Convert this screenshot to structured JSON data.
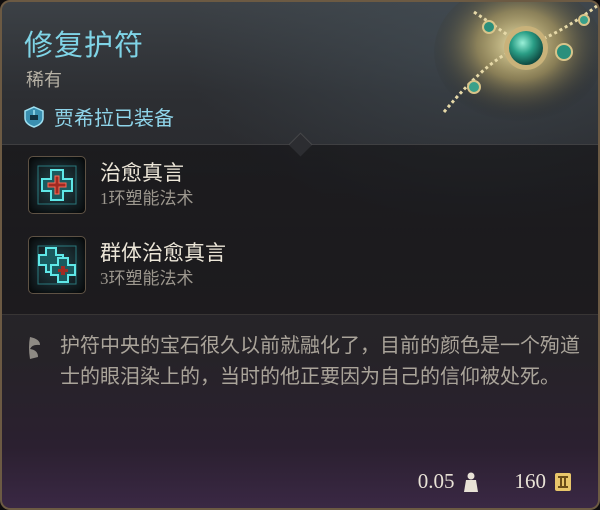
{
  "item": {
    "name": "修复护符",
    "rarity": "稀有",
    "equipped_label": "贾希拉已装备",
    "description": "护符中央的宝石很久以前就融化了，目前的颜色是一个殉道士的眼泪染上的，当时的他正要因为自己的信仰被处死。",
    "weight": "0.05",
    "price": "160"
  },
  "spells": [
    {
      "name": "治愈真言",
      "school": "1环塑能法术",
      "icon": "healing-word-icon"
    },
    {
      "name": "群体治愈真言",
      "school": "3环塑能法术",
      "icon": "mass-healing-word-icon"
    }
  ],
  "colors": {
    "title": "#7fd4e6",
    "equipped": "#8fd5ea",
    "border": "#6c5a43"
  }
}
